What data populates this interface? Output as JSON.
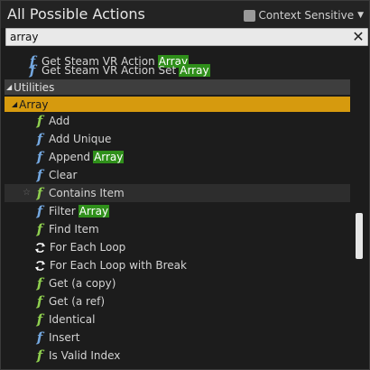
{
  "header": {
    "title": "All Possible Actions",
    "context_sensitive_label": "Context Sensitive",
    "context_sensitive_checked": false,
    "dropdown_icon": "triangle-down-icon"
  },
  "search": {
    "value": "array",
    "clear_icon": "close-icon"
  },
  "items_top": [
    {
      "prefix": "Get Steam VR Action",
      "match": "Array"
    },
    {
      "prefix": "Get Steam VR Action Set",
      "match": "Array"
    }
  ],
  "category": {
    "utilities": "Utilities",
    "array": "Array"
  },
  "array_items": [
    {
      "prefix": "Add",
      "match": "",
      "icon": "function-icon-green"
    },
    {
      "prefix": "Add Unique",
      "match": "",
      "icon": "function-icon-blue"
    },
    {
      "prefix": "Append",
      "match": "Array",
      "icon": "function-icon-blue"
    },
    {
      "prefix": "Clear",
      "match": "",
      "icon": "function-icon-blue"
    },
    {
      "prefix": "Contains Item",
      "match": "",
      "icon": "function-icon-green"
    },
    {
      "prefix": "Filter",
      "match": "Array",
      "icon": "function-icon-blue"
    },
    {
      "prefix": "Find Item",
      "match": "",
      "icon": "function-icon-green"
    },
    {
      "prefix": "For Each Loop",
      "match": "",
      "icon": "loop-icon"
    },
    {
      "prefix": "For Each Loop with Break",
      "match": "",
      "icon": "loop-icon"
    },
    {
      "prefix": "Get (a copy)",
      "match": "",
      "icon": "function-icon-green"
    },
    {
      "prefix": "Get (a ref)",
      "match": "",
      "icon": "function-icon-green"
    },
    {
      "prefix": "Identical",
      "match": "",
      "icon": "function-icon-green"
    },
    {
      "prefix": "Insert",
      "match": "",
      "icon": "function-icon-blue"
    },
    {
      "prefix": "Is Valid Index",
      "match": "",
      "icon": "function-icon-green"
    }
  ],
  "colors": {
    "highlight": "#2f8f1a",
    "selected_category": "#d69a0e",
    "function_blue": "#74a8e0",
    "function_green": "#8fcf4f"
  }
}
